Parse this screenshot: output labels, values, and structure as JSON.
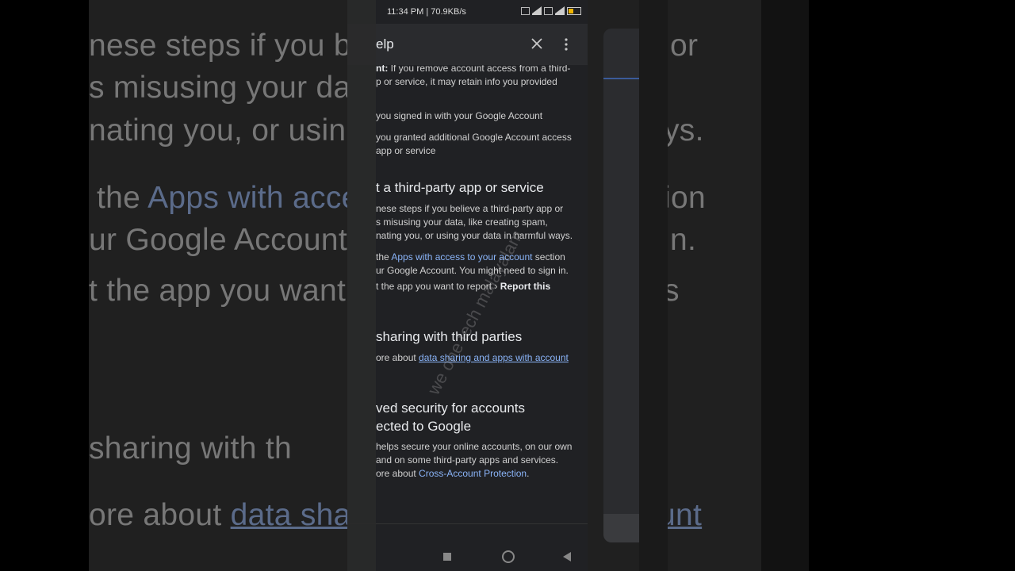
{
  "background": {
    "lines": [
      "nese steps if you be",
      "s misusing your data",
      "nating you, or using",
      "the",
      "Apps with acce",
      "ur Google Account.",
      "t the app you want",
      "sharing with th",
      "ore about",
      "data shar"
    ],
    "right_fragments": [
      "or",
      "ys.",
      "ion",
      "n.",
      "s",
      "unt"
    ]
  },
  "status_bar": {
    "text": "11:34 PM | 70.9KB/s"
  },
  "app_bar": {
    "title": "elp"
  },
  "content": {
    "p1_label": "nt:",
    "p1_line1": " If you remove account access from a third-",
    "p1_line2": "p or service, it may retain info you provided",
    "p2": "you signed in with your Google Account",
    "p3_line1": "you granted additional Google Account access",
    "p3_line2": "app or service",
    "h1": "t a third-party app or service",
    "p4_line1": "nese steps if you believe a third-party app or",
    "p4_line2": "s misusing your data, like creating spam,",
    "p4_line3": "nating you, or using your data in harmful ways.",
    "p5_prefix": "the ",
    "p5_link": "Apps with access to your account",
    "p5_suffix": " section",
    "p5_line2": "ur Google Account. You might need to sign in.",
    "p6_text": "t the app you want to report",
    "p6_arrow": "›",
    "p6_bold": "Report this",
    "h2": "sharing with third parties",
    "p7_prefix": "ore about ",
    "p7_link": "data sharing and apps with account",
    "h3_line1": "ved security for accounts",
    "h3_line2": "ected to Google",
    "p8_line1": "helps secure your online accounts, on our own",
    "p8_line2": "and on some third-party apps and services.",
    "p8_prefix": "ore about ",
    "p8_link": "Cross-Account Protection",
    "p8_suffix": "."
  },
  "watermark": "we one tech malayalam",
  "colors": {
    "link": "#8ab4f8",
    "background": "#202124",
    "appbar": "#2a2b2e"
  }
}
